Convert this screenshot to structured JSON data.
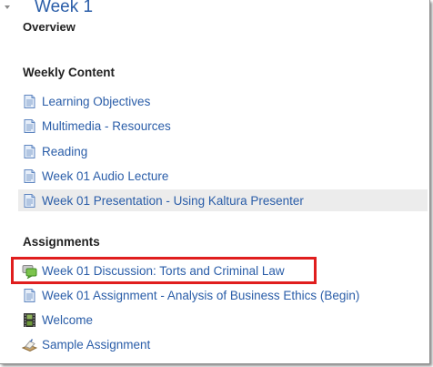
{
  "section": {
    "title": "Week 1",
    "overview_label": "Overview",
    "collapse_icon": "chevron-down-icon"
  },
  "weekly_content": {
    "heading": "Weekly Content",
    "items": [
      {
        "label": "Learning Objectives",
        "icon": "page-icon"
      },
      {
        "label": "Multimedia - Resources",
        "icon": "page-icon"
      },
      {
        "label": "Reading",
        "icon": "page-icon"
      },
      {
        "label": "Week 01 Audio Lecture",
        "icon": "page-icon"
      },
      {
        "label": "Week 01 Presentation - Using Kaltura Presenter",
        "icon": "page-icon",
        "highlighted": true
      }
    ]
  },
  "assignments": {
    "heading": "Assignments",
    "items": [
      {
        "label": "Week 01 Discussion: Torts and Criminal Law",
        "icon": "forum-icon",
        "annotated": true
      },
      {
        "label": "Week 01 Assignment - Analysis of Business Ethics (Begin)",
        "icon": "page-icon"
      },
      {
        "label": "Welcome",
        "icon": "film-icon"
      },
      {
        "label": "Sample Assignment",
        "icon": "assignment-icon"
      }
    ]
  },
  "colors": {
    "link": "#2a5da8",
    "annotation_box": "#e01e1e",
    "highlight_row": "#ececec"
  }
}
